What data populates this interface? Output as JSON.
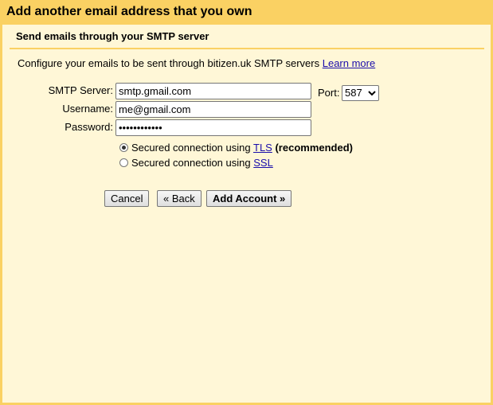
{
  "dialog": {
    "title": "Add another email address that you own",
    "subtitle": "Send emails through your SMTP server",
    "description": "Configure your emails to be sent through bitizen.uk SMTP servers",
    "learn_more": "Learn more"
  },
  "form": {
    "smtp_server_label": "SMTP Server:",
    "smtp_server_value": "smtp.gmail.com",
    "port_label": "Port:",
    "port_value": "587",
    "username_label": "Username:",
    "username_value": "me@gmail.com",
    "password_label": "Password:",
    "password_value": "••••••••••••"
  },
  "security": {
    "tls_prefix": "Secured connection using",
    "tls_link": "TLS",
    "tls_suffix": "(recommended)",
    "tls_selected": true,
    "ssl_prefix": "Secured connection using",
    "ssl_link": "SSL",
    "ssl_selected": false
  },
  "buttons": {
    "cancel": "Cancel",
    "back": "« Back",
    "add_account": "Add Account »"
  },
  "colors": {
    "header": "#fad163",
    "background": "#fff7d7",
    "link": "#1a0dab"
  }
}
